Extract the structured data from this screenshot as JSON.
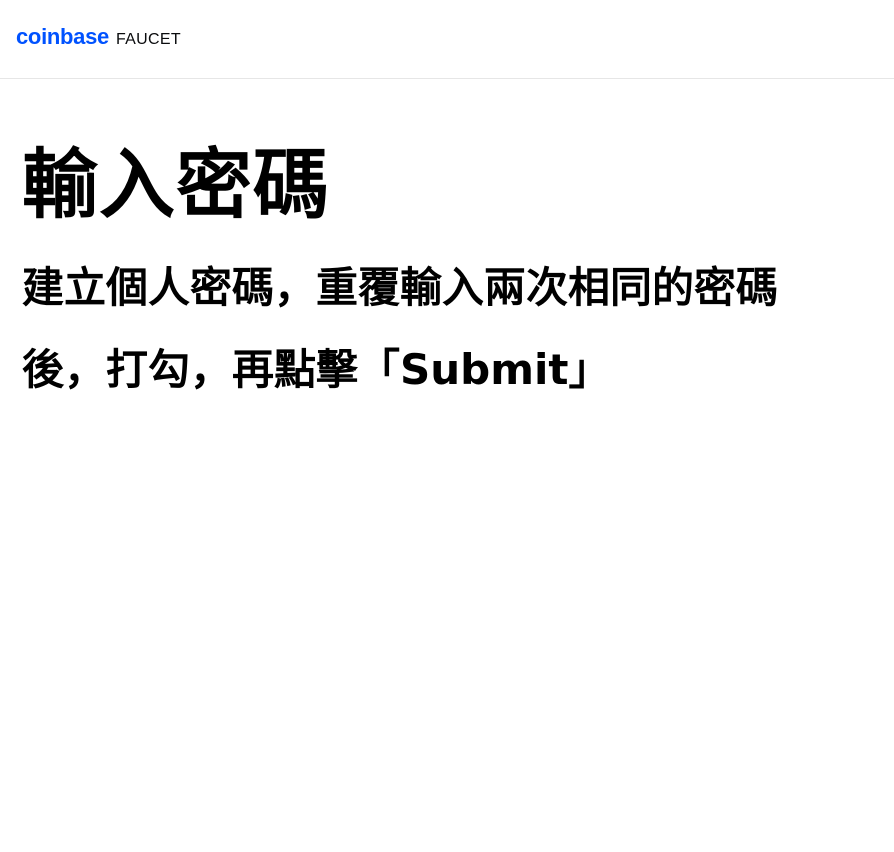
{
  "header": {
    "logo_text": "coinbase",
    "product_text": "FAUCET"
  },
  "main": {
    "title": "輸入密碼",
    "instruction": "建立個人密碼，重覆輸入兩次相同的密碼後，打勾，再點擊「Submit」"
  },
  "colors": {
    "brand": "#0052ff",
    "text": "#000000",
    "divider": "#e6e6e6",
    "background": "#ffffff"
  }
}
